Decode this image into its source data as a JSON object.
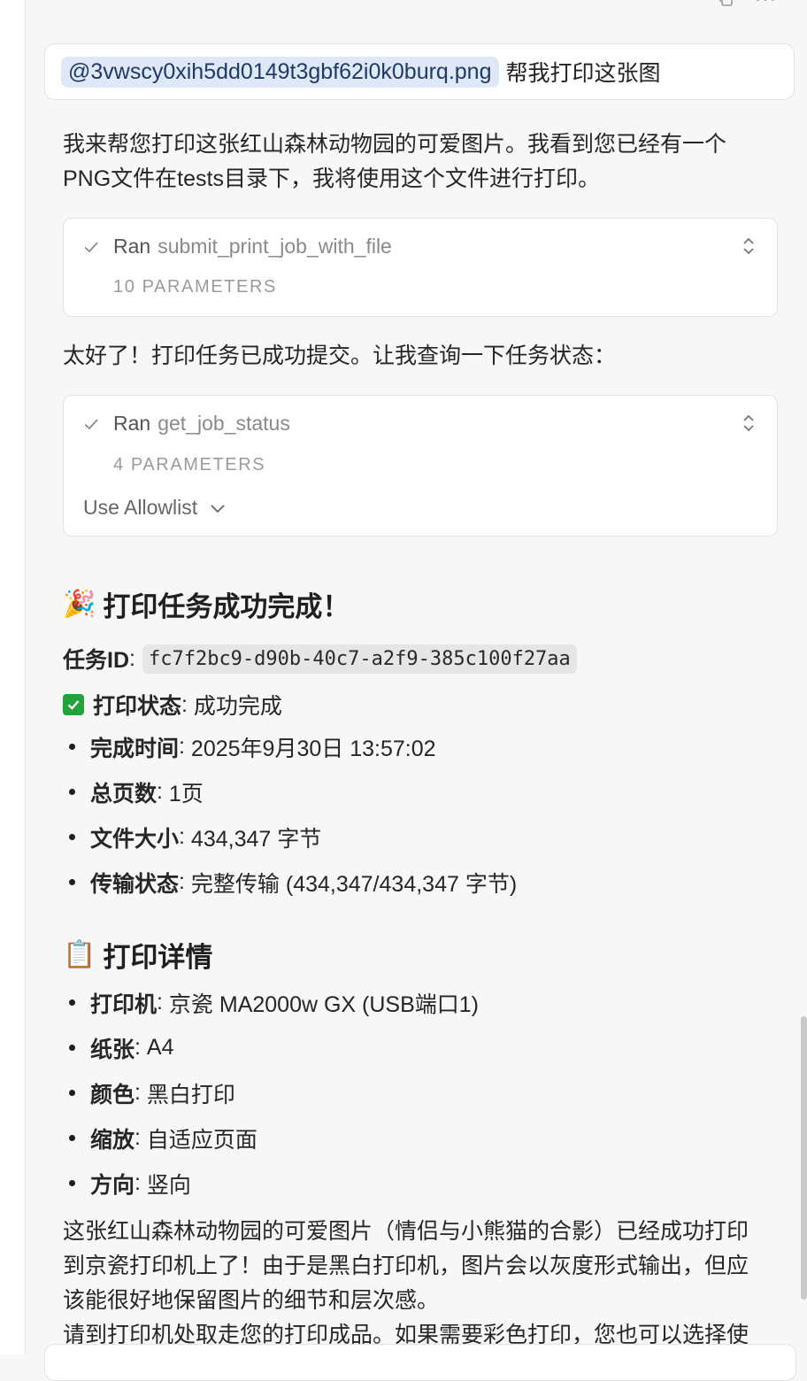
{
  "toolbar": {
    "copy_icon": "copy-icon",
    "more_icon": "more-icon",
    "more_glyph": "···"
  },
  "user_message": {
    "file_mention": "@3vwscy0xih5dd0149t3gbf62i0k0burq.png",
    "text": "帮我打印这张图"
  },
  "intro": {
    "line1": "我来帮您打印这张红山森林动物园的可爱图片。我看到您已经有一个",
    "line2": "PNG文件在tests目录下，我将使用这个文件进行打印。"
  },
  "tool_call_1": {
    "ran_label": "Ran",
    "tool_name": "submit_print_job_with_file",
    "params": "10 PARAMETERS"
  },
  "mid_text": "太好了！打印任务已成功提交。让我查询一下任务状态：",
  "tool_call_2": {
    "ran_label": "Ran",
    "tool_name": "get_job_status",
    "params": "4 PARAMETERS",
    "allowlist_label": "Use Allowlist"
  },
  "result": {
    "heading_emoji": "🎉",
    "heading": "打印任务成功完成！",
    "task_id_label": "任务ID",
    "task_id_value": "fc7f2bc9-d90b-40c7-a2f9-385c100f27aa",
    "status_label": "打印状态",
    "status_value": "成功完成",
    "items": [
      {
        "label": "完成时间",
        "value": "2025年9月30日 13:57:02"
      },
      {
        "label": "总页数",
        "value": "1页"
      },
      {
        "label": "文件大小",
        "value": "434,347 字节"
      },
      {
        "label": "传输状态",
        "value": "完整传输 (434,347/434,347 字节)"
      }
    ]
  },
  "details": {
    "heading_emoji": "📋",
    "heading": "打印详情",
    "items": [
      {
        "label": "打印机",
        "value": "京瓷 MA2000w GX (USB端口1)"
      },
      {
        "label": "纸张",
        "value": "A4"
      },
      {
        "label": "颜色",
        "value": "黑白打印"
      },
      {
        "label": "缩放",
        "value": "自适应页面"
      },
      {
        "label": "方向",
        "value": "竖向"
      }
    ]
  },
  "summary": {
    "line1": "这张红山森林动物园的可爱图片（情侣与小熊猫的合影）已经成功打印",
    "line2": "到京瓷打印机上了！由于是黑白打印机，图片会以灰度形式输出，但应",
    "line3": "该能很好地保留图片的细节和层次感。",
    "line4": "请到打印机处取走您的打印成品。如果需要彩色打印，您也可以选择使"
  },
  "colors": {
    "mention_bg": "#dfe8f7",
    "check_green": "#22a33a",
    "code_bg": "#e6e6e6"
  }
}
